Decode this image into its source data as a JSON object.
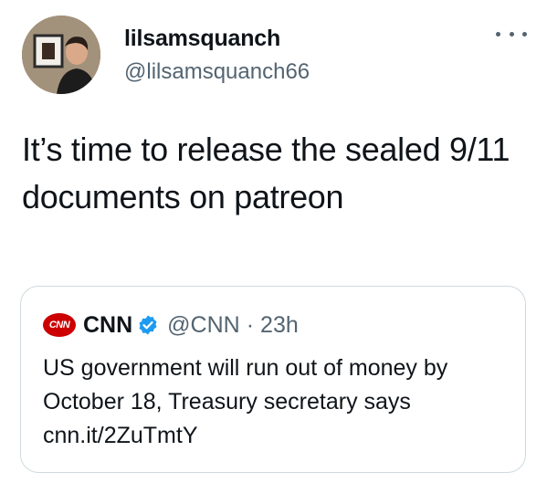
{
  "author": {
    "display_name": "lilsamsquanch",
    "handle": "@lilsamsquanch66"
  },
  "tweet": {
    "text": "It’s time to release the sealed 9/11 documents on patreon"
  },
  "quoted_tweet": {
    "logo_text": "CNN",
    "display_name": "CNN",
    "handle": "@CNN",
    "separator": "·",
    "time": "23h",
    "text_lines": [
      "US government will run out of money by",
      "October 18, Treasury secretary says",
      "cnn.it/2ZuTmtY"
    ]
  },
  "colors": {
    "text": "#0f1419",
    "secondary": "#536471",
    "border": "#cfd9de",
    "verified": "#1d9bf0",
    "cnn_red": "#cc0000"
  },
  "icons": {
    "more": "more-horizontal-icon",
    "verified": "verified-badge-icon"
  }
}
